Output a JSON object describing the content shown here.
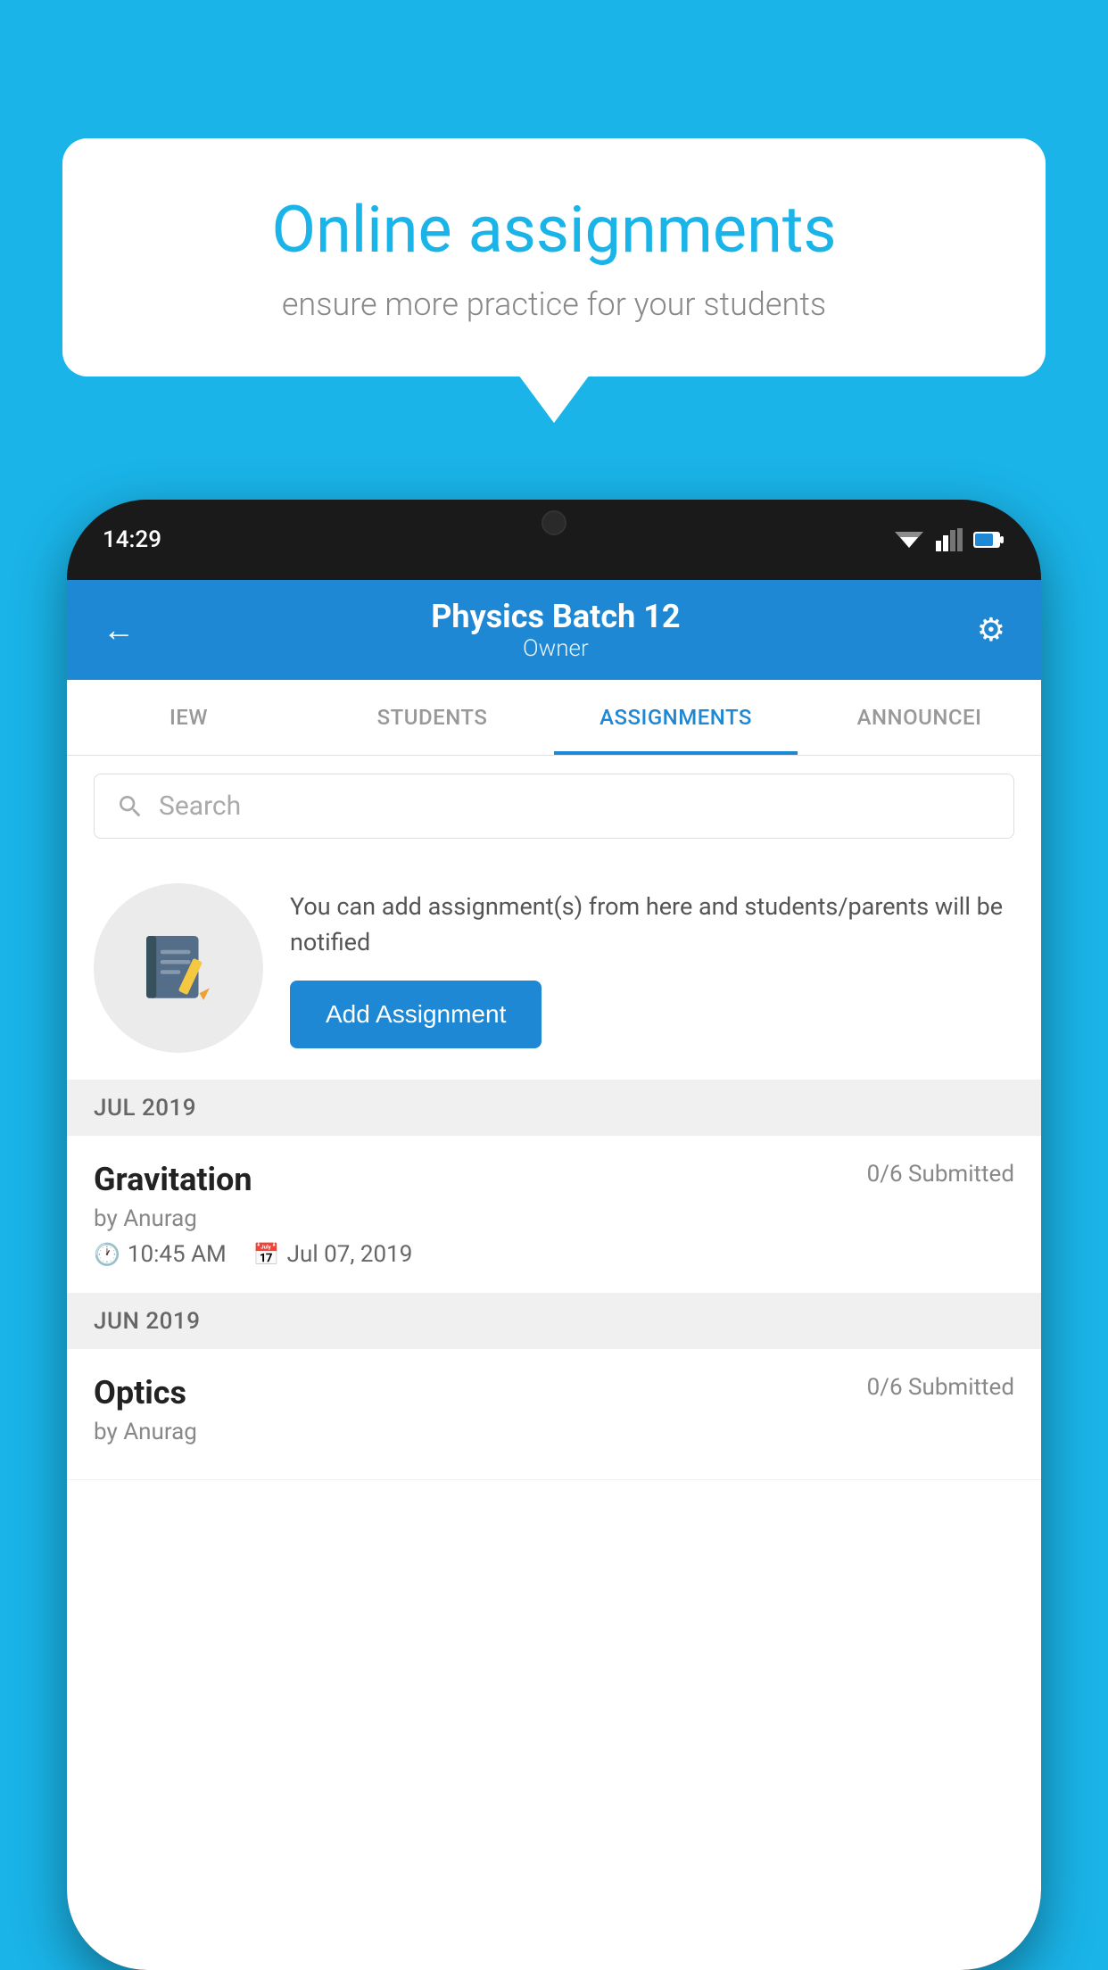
{
  "background_color": "#1ab4e8",
  "speech_bubble": {
    "title": "Online assignments",
    "subtitle": "ensure more practice for your students"
  },
  "status_bar": {
    "time": "14:29"
  },
  "app_header": {
    "title": "Physics Batch 12",
    "subtitle": "Owner",
    "back_icon": "←",
    "gear_icon": "⚙"
  },
  "tabs": [
    {
      "label": "IEW",
      "active": false
    },
    {
      "label": "STUDENTS",
      "active": false
    },
    {
      "label": "ASSIGNMENTS",
      "active": true
    },
    {
      "label": "ANNOUNCEI",
      "active": false
    }
  ],
  "search": {
    "placeholder": "Search"
  },
  "promo": {
    "text": "You can add assignment(s) from here and students/parents will be notified",
    "button_label": "Add Assignment"
  },
  "sections": [
    {
      "month": "JUL 2019",
      "assignments": [
        {
          "name": "Gravitation",
          "submitted": "0/6 Submitted",
          "by": "by Anurag",
          "time": "10:45 AM",
          "date": "Jul 07, 2019"
        }
      ]
    },
    {
      "month": "JUN 2019",
      "assignments": [
        {
          "name": "Optics",
          "submitted": "0/6 Submitted",
          "by": "by Anurag",
          "time": "",
          "date": ""
        }
      ]
    }
  ]
}
